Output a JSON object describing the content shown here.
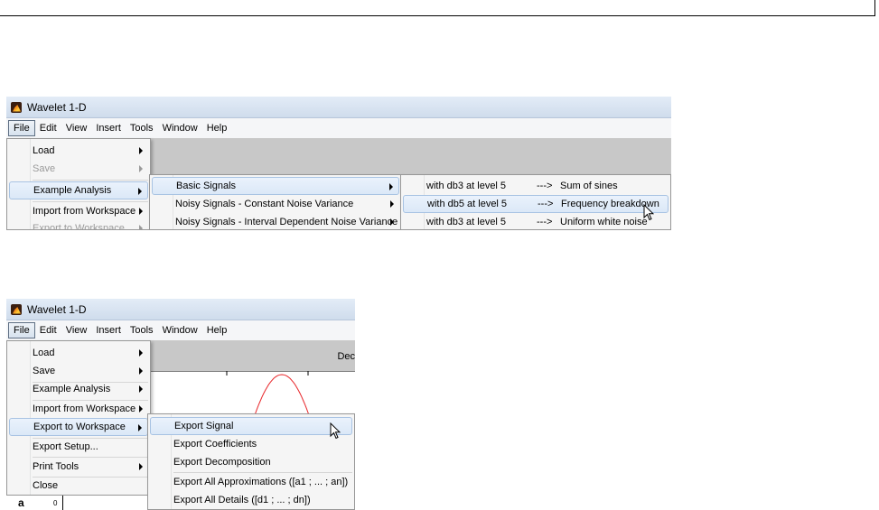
{
  "shot1": {
    "window_title": "Wavelet 1-D",
    "menubar": [
      "File",
      "Edit",
      "View",
      "Insert",
      "Tools",
      "Window",
      "Help"
    ],
    "file_menu": [
      {
        "label": "Load",
        "submenu": true,
        "disabled": false
      },
      {
        "label": "Save",
        "submenu": true,
        "disabled": true
      },
      {
        "label": "Example Analysis",
        "submenu": true,
        "disabled": false,
        "highlighted": true
      },
      {
        "label": "Import from Workspace",
        "submenu": true,
        "disabled": false
      },
      {
        "label": "Export to Workspace",
        "submenu": true,
        "disabled": true
      }
    ],
    "example_menu": [
      {
        "label": "Basic Signals",
        "highlighted": true
      },
      {
        "label": "Noisy Signals - Constant Noise Variance"
      },
      {
        "label": "Noisy Signals - Interval Dependent Noise Variance"
      }
    ],
    "basic_signals_menu": [
      {
        "prefix": "with db3 at level 5",
        "arrow": "--->",
        "label": "Sum of sines"
      },
      {
        "prefix": "with db5 at level 5",
        "arrow": "--->",
        "label": "Frequency breakdown",
        "highlighted": true
      },
      {
        "prefix": "with db3 at level 5",
        "arrow": "--->",
        "label": "Uniform white noise"
      }
    ]
  },
  "shot2": {
    "window_title": "Wavelet 1-D",
    "menubar": [
      "File",
      "Edit",
      "View",
      "Insert",
      "Tools",
      "Window",
      "Help"
    ],
    "file_menu": {
      "load": "Load",
      "save": "Save",
      "example": "Example Analysis",
      "import": "Import from Workspace",
      "export": "Export to Workspace",
      "export_setup": "Export Setup...",
      "print_tools": "Print Tools",
      "close": "Close"
    },
    "export_menu": {
      "signal": "Export Signal",
      "coefficients": "Export Coefficients",
      "decomposition": "Export Decomposition",
      "approximations": "Export All Approximations ([a1 ; ... ; an])",
      "details": "Export All Details ([d1 ; ... ; dn])"
    },
    "panel_label": "Dec",
    "axis_label": "a",
    "axis_tick": "0",
    "curve_color": "#e8262a"
  }
}
